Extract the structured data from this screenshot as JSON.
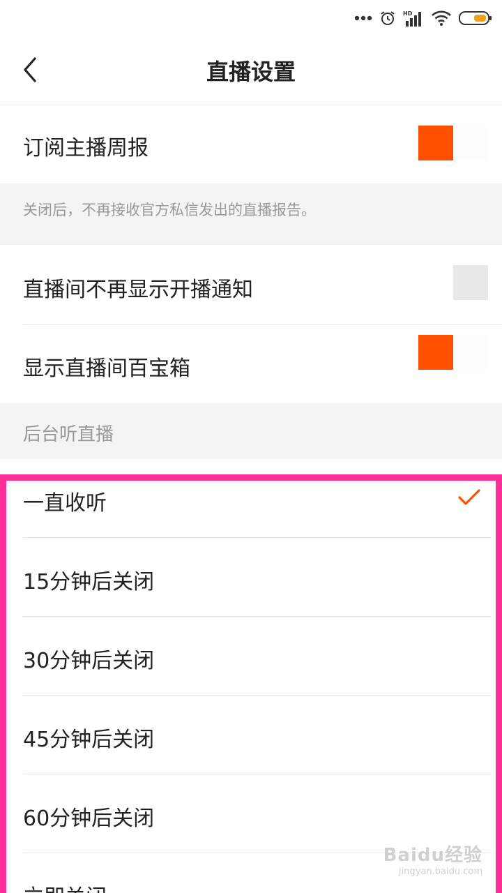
{
  "header": {
    "title": "直播设置"
  },
  "settings": {
    "subscribe_weekly": {
      "label": "订阅主播周报",
      "on": true
    },
    "subscribe_hint": "关闭后，不再接收官方私信发出的直播报告。",
    "hide_live_notice": {
      "label": "直播间不再显示开播通知",
      "on": false
    },
    "show_treasure_box": {
      "label": "显示直播间百宝箱",
      "on": true
    }
  },
  "background_listen": {
    "section_title": "后台听直播",
    "options": [
      {
        "label": "一直收听",
        "selected": true
      },
      {
        "label": "15分钟后关闭",
        "selected": false
      },
      {
        "label": "30分钟后关闭",
        "selected": false
      },
      {
        "label": "45分钟后关闭",
        "selected": false
      },
      {
        "label": "60分钟后关闭",
        "selected": false
      },
      {
        "label": "立即关闭",
        "selected": false
      }
    ]
  },
  "watermark": {
    "main": "Baidu经验",
    "sub": "jingyan.baidu.com"
  },
  "colors": {
    "accent": "#ff5000",
    "highlight_border": "#ff2d97"
  }
}
